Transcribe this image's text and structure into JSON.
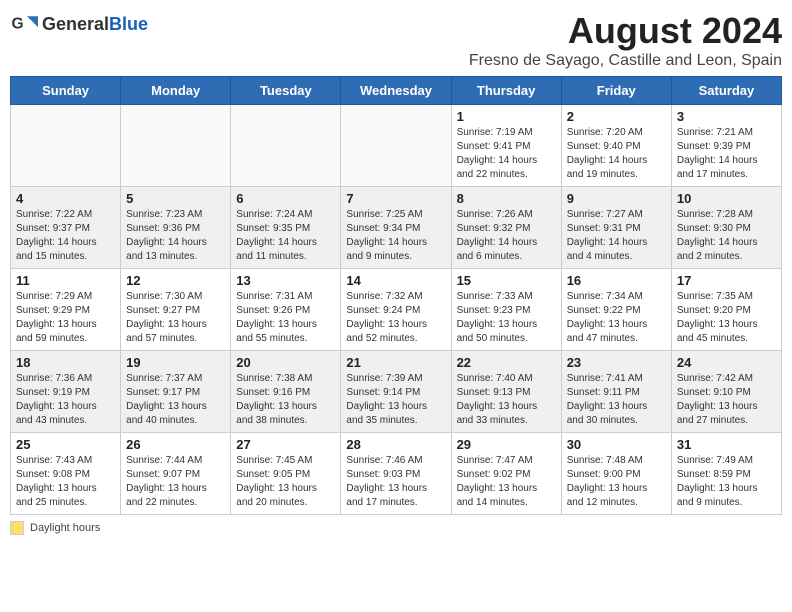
{
  "header": {
    "logo_general": "General",
    "logo_blue": "Blue",
    "month_year": "August 2024",
    "location": "Fresno de Sayago, Castille and Leon, Spain"
  },
  "weekdays": [
    "Sunday",
    "Monday",
    "Tuesday",
    "Wednesday",
    "Thursday",
    "Friday",
    "Saturday"
  ],
  "legend": {
    "label": "Daylight hours"
  },
  "days": [
    {
      "date": "",
      "info": ""
    },
    {
      "date": "",
      "info": ""
    },
    {
      "date": "",
      "info": ""
    },
    {
      "date": "",
      "info": ""
    },
    {
      "date": "1",
      "info": "Sunrise: 7:19 AM\nSunset: 9:41 PM\nDaylight: 14 hours\nand 22 minutes."
    },
    {
      "date": "2",
      "info": "Sunrise: 7:20 AM\nSunset: 9:40 PM\nDaylight: 14 hours\nand 19 minutes."
    },
    {
      "date": "3",
      "info": "Sunrise: 7:21 AM\nSunset: 9:39 PM\nDaylight: 14 hours\nand 17 minutes."
    },
    {
      "date": "4",
      "info": "Sunrise: 7:22 AM\nSunset: 9:37 PM\nDaylight: 14 hours\nand 15 minutes."
    },
    {
      "date": "5",
      "info": "Sunrise: 7:23 AM\nSunset: 9:36 PM\nDaylight: 14 hours\nand 13 minutes."
    },
    {
      "date": "6",
      "info": "Sunrise: 7:24 AM\nSunset: 9:35 PM\nDaylight: 14 hours\nand 11 minutes."
    },
    {
      "date": "7",
      "info": "Sunrise: 7:25 AM\nSunset: 9:34 PM\nDaylight: 14 hours\nand 9 minutes."
    },
    {
      "date": "8",
      "info": "Sunrise: 7:26 AM\nSunset: 9:32 PM\nDaylight: 14 hours\nand 6 minutes."
    },
    {
      "date": "9",
      "info": "Sunrise: 7:27 AM\nSunset: 9:31 PM\nDaylight: 14 hours\nand 4 minutes."
    },
    {
      "date": "10",
      "info": "Sunrise: 7:28 AM\nSunset: 9:30 PM\nDaylight: 14 hours\nand 2 minutes."
    },
    {
      "date": "11",
      "info": "Sunrise: 7:29 AM\nSunset: 9:29 PM\nDaylight: 13 hours\nand 59 minutes."
    },
    {
      "date": "12",
      "info": "Sunrise: 7:30 AM\nSunset: 9:27 PM\nDaylight: 13 hours\nand 57 minutes."
    },
    {
      "date": "13",
      "info": "Sunrise: 7:31 AM\nSunset: 9:26 PM\nDaylight: 13 hours\nand 55 minutes."
    },
    {
      "date": "14",
      "info": "Sunrise: 7:32 AM\nSunset: 9:24 PM\nDaylight: 13 hours\nand 52 minutes."
    },
    {
      "date": "15",
      "info": "Sunrise: 7:33 AM\nSunset: 9:23 PM\nDaylight: 13 hours\nand 50 minutes."
    },
    {
      "date": "16",
      "info": "Sunrise: 7:34 AM\nSunset: 9:22 PM\nDaylight: 13 hours\nand 47 minutes."
    },
    {
      "date": "17",
      "info": "Sunrise: 7:35 AM\nSunset: 9:20 PM\nDaylight: 13 hours\nand 45 minutes."
    },
    {
      "date": "18",
      "info": "Sunrise: 7:36 AM\nSunset: 9:19 PM\nDaylight: 13 hours\nand 43 minutes."
    },
    {
      "date": "19",
      "info": "Sunrise: 7:37 AM\nSunset: 9:17 PM\nDaylight: 13 hours\nand 40 minutes."
    },
    {
      "date": "20",
      "info": "Sunrise: 7:38 AM\nSunset: 9:16 PM\nDaylight: 13 hours\nand 38 minutes."
    },
    {
      "date": "21",
      "info": "Sunrise: 7:39 AM\nSunset: 9:14 PM\nDaylight: 13 hours\nand 35 minutes."
    },
    {
      "date": "22",
      "info": "Sunrise: 7:40 AM\nSunset: 9:13 PM\nDaylight: 13 hours\nand 33 minutes."
    },
    {
      "date": "23",
      "info": "Sunrise: 7:41 AM\nSunset: 9:11 PM\nDaylight: 13 hours\nand 30 minutes."
    },
    {
      "date": "24",
      "info": "Sunrise: 7:42 AM\nSunset: 9:10 PM\nDaylight: 13 hours\nand 27 minutes."
    },
    {
      "date": "25",
      "info": "Sunrise: 7:43 AM\nSunset: 9:08 PM\nDaylight: 13 hours\nand 25 minutes."
    },
    {
      "date": "26",
      "info": "Sunrise: 7:44 AM\nSunset: 9:07 PM\nDaylight: 13 hours\nand 22 minutes."
    },
    {
      "date": "27",
      "info": "Sunrise: 7:45 AM\nSunset: 9:05 PM\nDaylight: 13 hours\nand 20 minutes."
    },
    {
      "date": "28",
      "info": "Sunrise: 7:46 AM\nSunset: 9:03 PM\nDaylight: 13 hours\nand 17 minutes."
    },
    {
      "date": "29",
      "info": "Sunrise: 7:47 AM\nSunset: 9:02 PM\nDaylight: 13 hours\nand 14 minutes."
    },
    {
      "date": "30",
      "info": "Sunrise: 7:48 AM\nSunset: 9:00 PM\nDaylight: 13 hours\nand 12 minutes."
    },
    {
      "date": "31",
      "info": "Sunrise: 7:49 AM\nSunset: 8:59 PM\nDaylight: 13 hours\nand 9 minutes."
    }
  ]
}
